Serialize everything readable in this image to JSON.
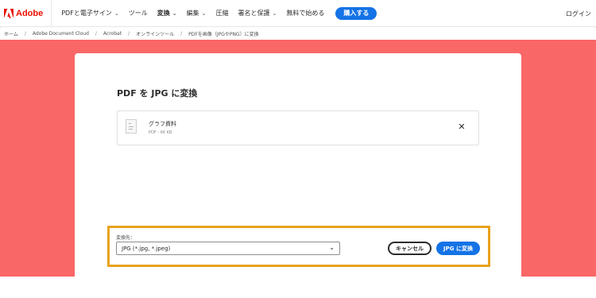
{
  "header": {
    "brand": "Adobe",
    "nav": [
      {
        "label": "PDFと電子サイン",
        "has_menu": true
      },
      {
        "label": "ツール",
        "has_menu": false
      },
      {
        "label": "変換",
        "has_menu": true,
        "active": true
      },
      {
        "label": "編集",
        "has_menu": true
      },
      {
        "label": "圧縮",
        "has_menu": false
      },
      {
        "label": "署名と保護",
        "has_menu": true
      },
      {
        "label": "無料で始める",
        "has_menu": false
      }
    ],
    "buy_button": "購入する",
    "login": "ログイン"
  },
  "breadcrumb": [
    "ホーム",
    "Adobe Document Cloud",
    "Acrobat",
    "オンラインツール",
    "PDFを画像（JPGやPNG）に変換"
  ],
  "card": {
    "title": "PDF を JPG に変換",
    "file": {
      "name": "グラフ資料",
      "meta": "PDF - 66 KB"
    },
    "target_label": "変換先：",
    "format_value": "JPG (*.jpg, *.jpeg)",
    "cancel_button": "キャンセル",
    "convert_button": "JPG に変換"
  },
  "colors": {
    "hero_bg": "#fa6767",
    "accent_blue": "#1473e6",
    "highlight": "#e8a21b",
    "brand_red": "#eb1000"
  },
  "icons": {
    "logo": "adobe-logo",
    "dropdown": "chevron-down-icon",
    "remove": "close-icon",
    "file": "pdf-file-icon"
  }
}
